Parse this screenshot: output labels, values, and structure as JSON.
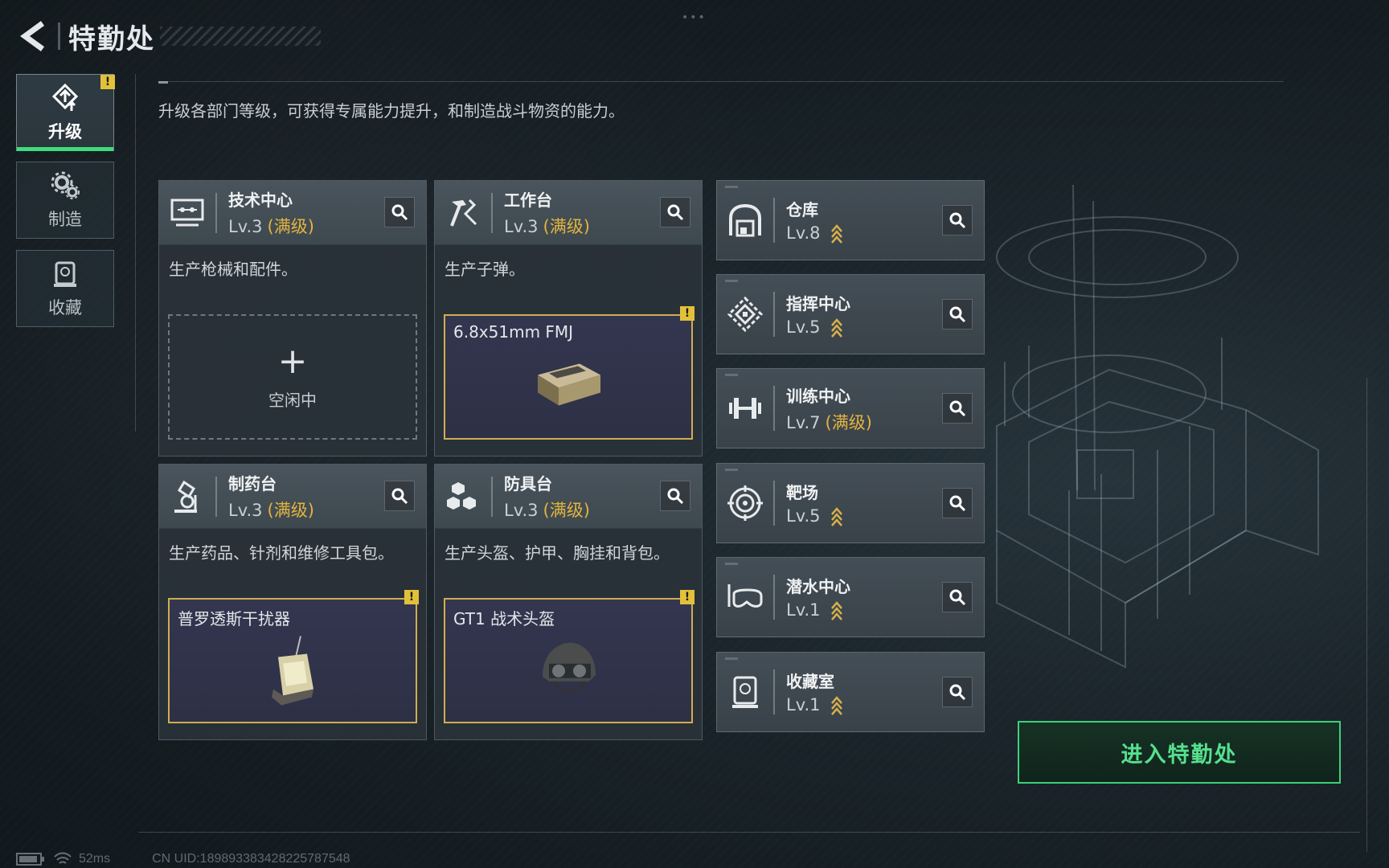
{
  "header": {
    "title": "特勤处"
  },
  "nav": [
    {
      "label": "升级",
      "icon": "upgrade-icon",
      "active": true,
      "badge": "!"
    },
    {
      "label": "制造",
      "icon": "gears-icon",
      "active": false
    },
    {
      "label": "收藏",
      "icon": "collection-icon",
      "active": false
    }
  ],
  "description": "升级各部门等级，可获得专属能力提升，和制造战斗物资的能力。",
  "cards": [
    {
      "name": "技术中心",
      "level": "Lv.3",
      "maxed": "(满级)",
      "desc": "生产枪械和配件。",
      "slot_state": "空闲中",
      "slot_plus": "+"
    },
    {
      "name": "工作台",
      "level": "Lv.3",
      "maxed": "(满级)",
      "desc": "生产子弹。",
      "item": "6.8x51mm FMJ",
      "badge": "!"
    },
    {
      "name": "制药台",
      "level": "Lv.3",
      "maxed": "(满级)",
      "desc": "生产药品、针剂和维修工具包。",
      "item": "普罗透斯干扰器",
      "badge": "!"
    },
    {
      "name": "防具台",
      "level": "Lv.3",
      "maxed": "(满级)",
      "desc": "生产头盔、护甲、胸挂和背包。",
      "item": "GT1 战术头盔",
      "badge": "!"
    }
  ],
  "facilities": [
    {
      "name": "仓库",
      "level": "Lv.8",
      "upgradable": true,
      "icon": "warehouse-icon"
    },
    {
      "name": "指挥中心",
      "level": "Lv.5",
      "upgradable": true,
      "icon": "command-icon"
    },
    {
      "name": "训练中心",
      "level": "Lv.7",
      "maxed": "(满级)",
      "icon": "dumbbell-icon"
    },
    {
      "name": "靶场",
      "level": "Lv.5",
      "upgradable": true,
      "icon": "target-icon"
    },
    {
      "name": "潜水中心",
      "level": "Lv.1",
      "upgradable": true,
      "icon": "diving-mask-icon"
    },
    {
      "name": "收藏室",
      "level": "Lv.1",
      "upgradable": true,
      "icon": "collection-room-icon"
    }
  ],
  "enter_button": "进入特勤处",
  "footer": {
    "ping": "52ms",
    "uid": "CN UID:18989338342822578754­8"
  },
  "colors": {
    "accent": "#3fdc7c",
    "maxed": "#e3b43e",
    "warning": "#e2c13a"
  }
}
